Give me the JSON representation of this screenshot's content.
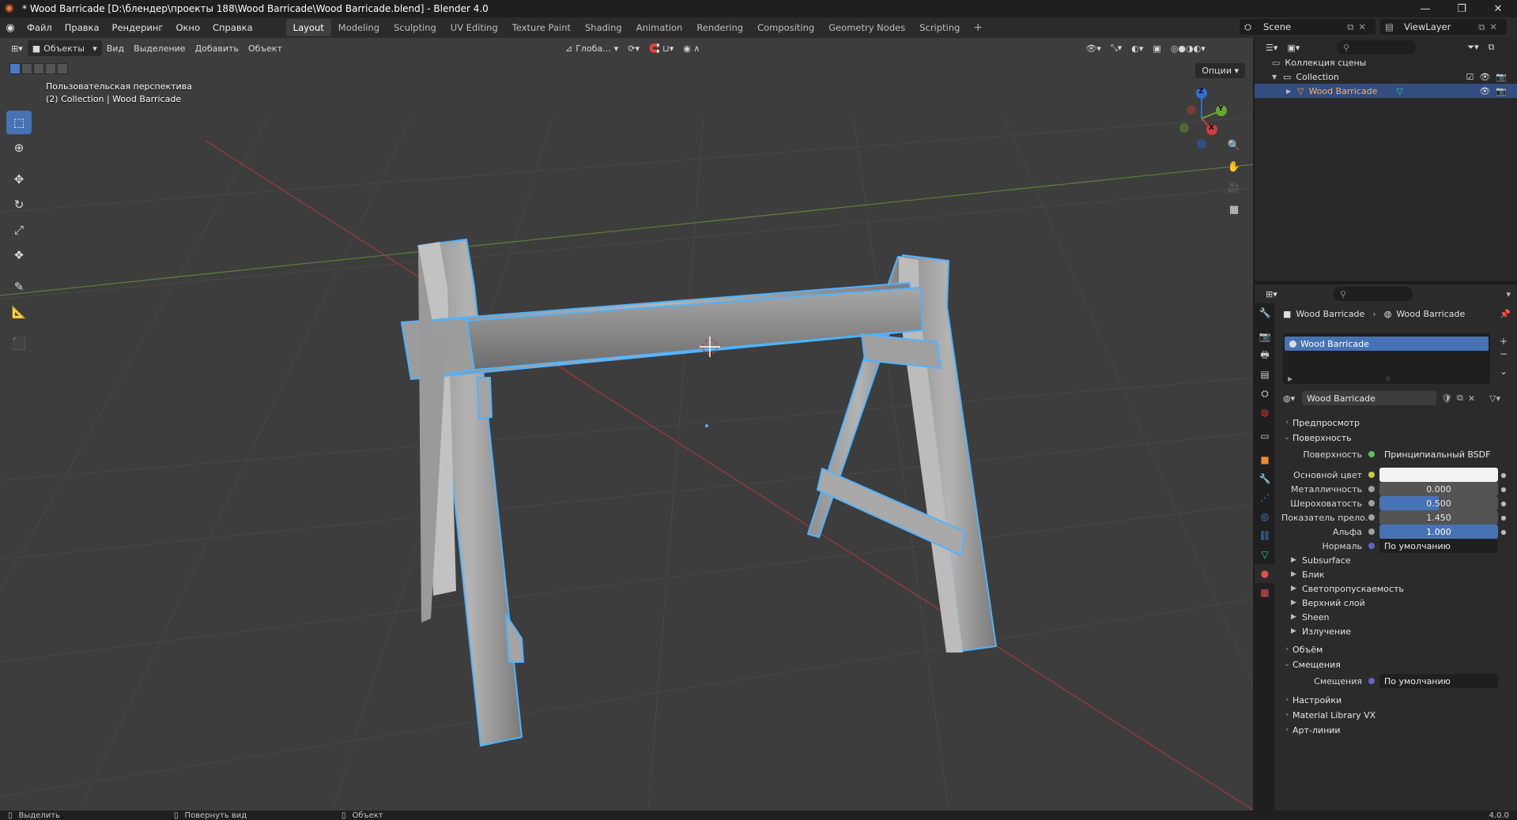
{
  "window": {
    "title": "* Wood Barricade [D:\\блендер\\проекты 188\\Wood Barricade\\Wood Barricade.blend] - Blender 4.0",
    "controls": [
      "—",
      "❐",
      "✕"
    ]
  },
  "menu": {
    "items": [
      "Файл",
      "Правка",
      "Рендеринг",
      "Окно",
      "Справка"
    ]
  },
  "workspaces": {
    "tabs": [
      "Layout",
      "Modeling",
      "Sculpting",
      "UV Editing",
      "Texture Paint",
      "Shading",
      "Animation",
      "Rendering",
      "Compositing",
      "Geometry Nodes",
      "Scripting"
    ],
    "active": "Layout",
    "add": "+"
  },
  "scene": {
    "name": "Scene",
    "view_layer": "ViewLayer"
  },
  "viewport": {
    "mode": "Объекты",
    "menus": [
      "Вид",
      "Выделение",
      "Добавить",
      "Объект"
    ],
    "orientation": "Глоба...",
    "options": "Опции",
    "view_name": "Пользовательская перспектива",
    "context": "(2) Collection | Wood Barricade",
    "gizmo_axes": {
      "x": "X",
      "y": "Y",
      "z": "Z"
    }
  },
  "outliner": {
    "root": "Коллекция сцены",
    "collection": "Collection",
    "object": "Wood Barricade"
  },
  "properties": {
    "breadcrumb_object": "Wood Barricade",
    "breadcrumb_material": "Wood Barricade",
    "slot": "Wood Barricade",
    "material_name": "Wood Barricade",
    "panels": {
      "preview": "Предпросмотр",
      "surface": "Поверхность",
      "volume": "Объём",
      "displacement": "Смещения",
      "settings": "Настройки",
      "mat_library": "Material Library VX",
      "line_art": "Арт-линии"
    },
    "surface_rows": [
      {
        "label": "Поверхность",
        "value": "Принципиальный BSDF",
        "dot": "#5fbf4f",
        "style": "dark"
      },
      {
        "label": "Основной цвет",
        "value": "",
        "dot": "#c9c94a",
        "style": "white"
      },
      {
        "label": "Металличность",
        "value": "0.000",
        "dot": "#a0a0a0",
        "style": "gray"
      },
      {
        "label": "Шероховатость",
        "value": "0.500",
        "dot": "#a0a0a0",
        "style": "blue"
      },
      {
        "label": "Показатель прело...",
        "value": "1.450",
        "dot": "#a0a0a0",
        "style": "gray"
      },
      {
        "label": "Альфа",
        "value": "1.000",
        "dot": "#a0a0a0",
        "style": "blue"
      },
      {
        "label": "Нормаль",
        "value": "По умолчанию",
        "dot": "#6363c7",
        "style": "dark"
      }
    ],
    "subpanels": [
      "Subsurface",
      "Блик",
      "Светопропускаемость",
      "Верхний слой",
      "Sheen",
      "Излучение"
    ],
    "displacement_row": {
      "label": "Смещения",
      "value": "По умолчанию"
    }
  },
  "status": {
    "select": "Выделить",
    "rotate": "Повернуть вид",
    "object": "Объект",
    "version": "4.0.0"
  }
}
